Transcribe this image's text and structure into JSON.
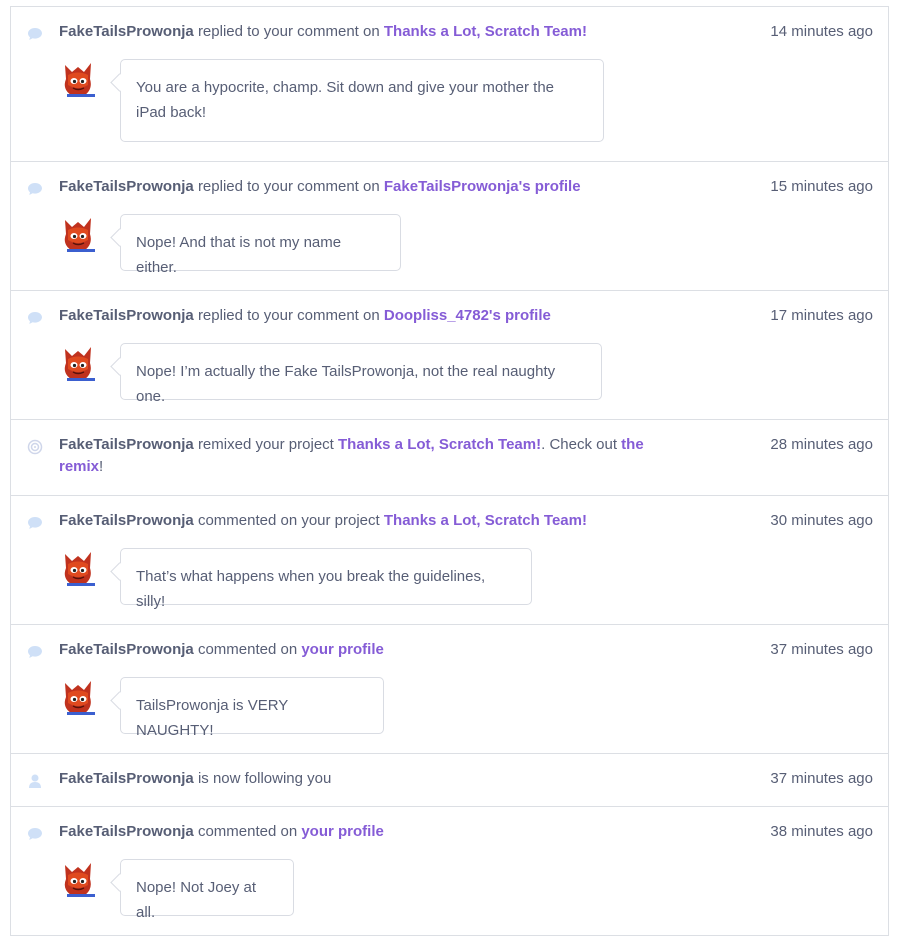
{
  "colors": {
    "link": "#855cd6",
    "text": "#575e75",
    "border": "#dcdfe4",
    "icon": "#cfe0f7"
  },
  "notifications": [
    {
      "type": "reply",
      "icon": "comment-icon",
      "user": "FakeTailsProwonja",
      "action": "replied to your comment on",
      "link": "Thanks a Lot, Scratch Team!",
      "time": "14 minutes ago",
      "comment": "You are a hypocrite, champ. Sit down and give your mother the iPad back!"
    },
    {
      "type": "reply",
      "icon": "comment-icon",
      "user": "FakeTailsProwonja",
      "action": "replied to your comment on",
      "link": "FakeTailsProwonja's profile",
      "time": "15 minutes ago",
      "comment": "Nope! And that is not my name either."
    },
    {
      "type": "reply",
      "icon": "comment-icon",
      "user": "FakeTailsProwonja",
      "action": "replied to your comment on",
      "link": "Doopliss_4782's profile",
      "time": "17 minutes ago",
      "comment": "Nope! I’m actually the Fake TailsProwonja, not the real naughty one."
    },
    {
      "type": "remix",
      "icon": "remix-icon",
      "user": "FakeTailsProwonja",
      "action": "remixed your project",
      "link": "Thanks a Lot, Scratch Team!",
      "action2": ". Check out",
      "link2": "the remix",
      "end": "!",
      "time": "28 minutes ago"
    },
    {
      "type": "comment",
      "icon": "comment-icon",
      "user": "FakeTailsProwonja",
      "action": "commented on your project",
      "link": "Thanks a Lot, Scratch Team!",
      "time": "30 minutes ago",
      "comment": "That’s what happens when you break the guidelines, silly!"
    },
    {
      "type": "comment",
      "icon": "comment-icon",
      "user": "FakeTailsProwonja",
      "action": "commented on",
      "link": "your profile",
      "time": "37 minutes ago",
      "comment": "TailsProwonja is VERY NAUGHTY!"
    },
    {
      "type": "follow",
      "icon": "user-icon",
      "user": "FakeTailsProwonja",
      "action": "is now following you",
      "time": "37 minutes ago"
    },
    {
      "type": "comment",
      "icon": "comment-icon",
      "user": "FakeTailsProwonja",
      "action": "commented on",
      "link": "your profile",
      "time": "38 minutes ago",
      "comment": "Nope! Not Joey at all."
    }
  ]
}
